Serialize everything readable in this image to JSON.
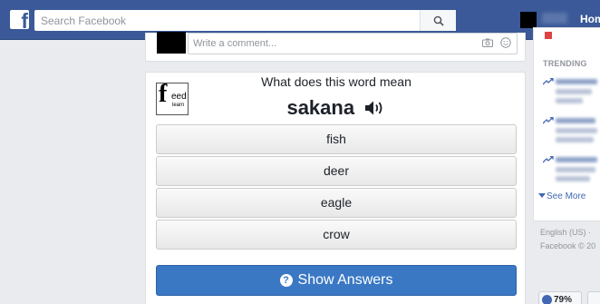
{
  "header": {
    "logo": "f",
    "search_placeholder": "Search Facebook",
    "home_label": "Hom"
  },
  "comment": {
    "placeholder": "Write a comment..."
  },
  "quiz": {
    "logo_letter": "f",
    "logo_line1": "eed",
    "logo_line2": "learn",
    "question": "What does this word mean",
    "word": "sakana",
    "options": [
      "fish",
      "deer",
      "eagle",
      "crow"
    ],
    "show_answers_label": "Show Answers",
    "show_answers_icon": "?"
  },
  "sidebar": {
    "trending_label": "TRENDING",
    "see_more_label": "See More",
    "language": "English (US) ·",
    "copyright": "Facebook © 20"
  },
  "status": {
    "percent": "79%"
  },
  "colors": {
    "brand_blue": "#3b5998",
    "button_blue": "#3a78c4",
    "page_bg": "#e9ebee"
  }
}
